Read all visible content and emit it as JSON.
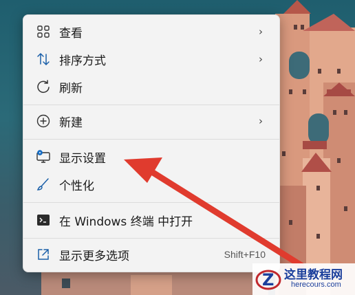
{
  "menu": {
    "items": [
      {
        "label": "查看",
        "icon": "grid-icon",
        "has_submenu": true
      },
      {
        "label": "排序方式",
        "icon": "sort-icon",
        "has_submenu": true
      },
      {
        "label": "刷新",
        "icon": "refresh-icon",
        "has_submenu": false
      },
      {
        "label": "新建",
        "icon": "plus-circle-icon",
        "has_submenu": true
      },
      {
        "label": "显示设置",
        "icon": "monitor-settings-icon",
        "has_submenu": false
      },
      {
        "label": "个性化",
        "icon": "brush-icon",
        "has_submenu": false
      },
      {
        "label": "在 Windows 终端 中打开",
        "icon": "terminal-icon",
        "has_submenu": false
      },
      {
        "label": "显示更多选项",
        "icon": "share-icon",
        "has_submenu": false,
        "shortcut": "Shift+F10"
      }
    ],
    "submenu_arrow": "›"
  },
  "annotation": {
    "color": "#e03b2e",
    "target": "显示设置"
  },
  "watermark": {
    "title": "这里教程网",
    "url": "herecours.com",
    "logo_letter": "Z"
  },
  "colors": {
    "menu_bg": "#f3f3f3",
    "accent": "#0067c0",
    "arrow_red": "#e03b2e"
  }
}
